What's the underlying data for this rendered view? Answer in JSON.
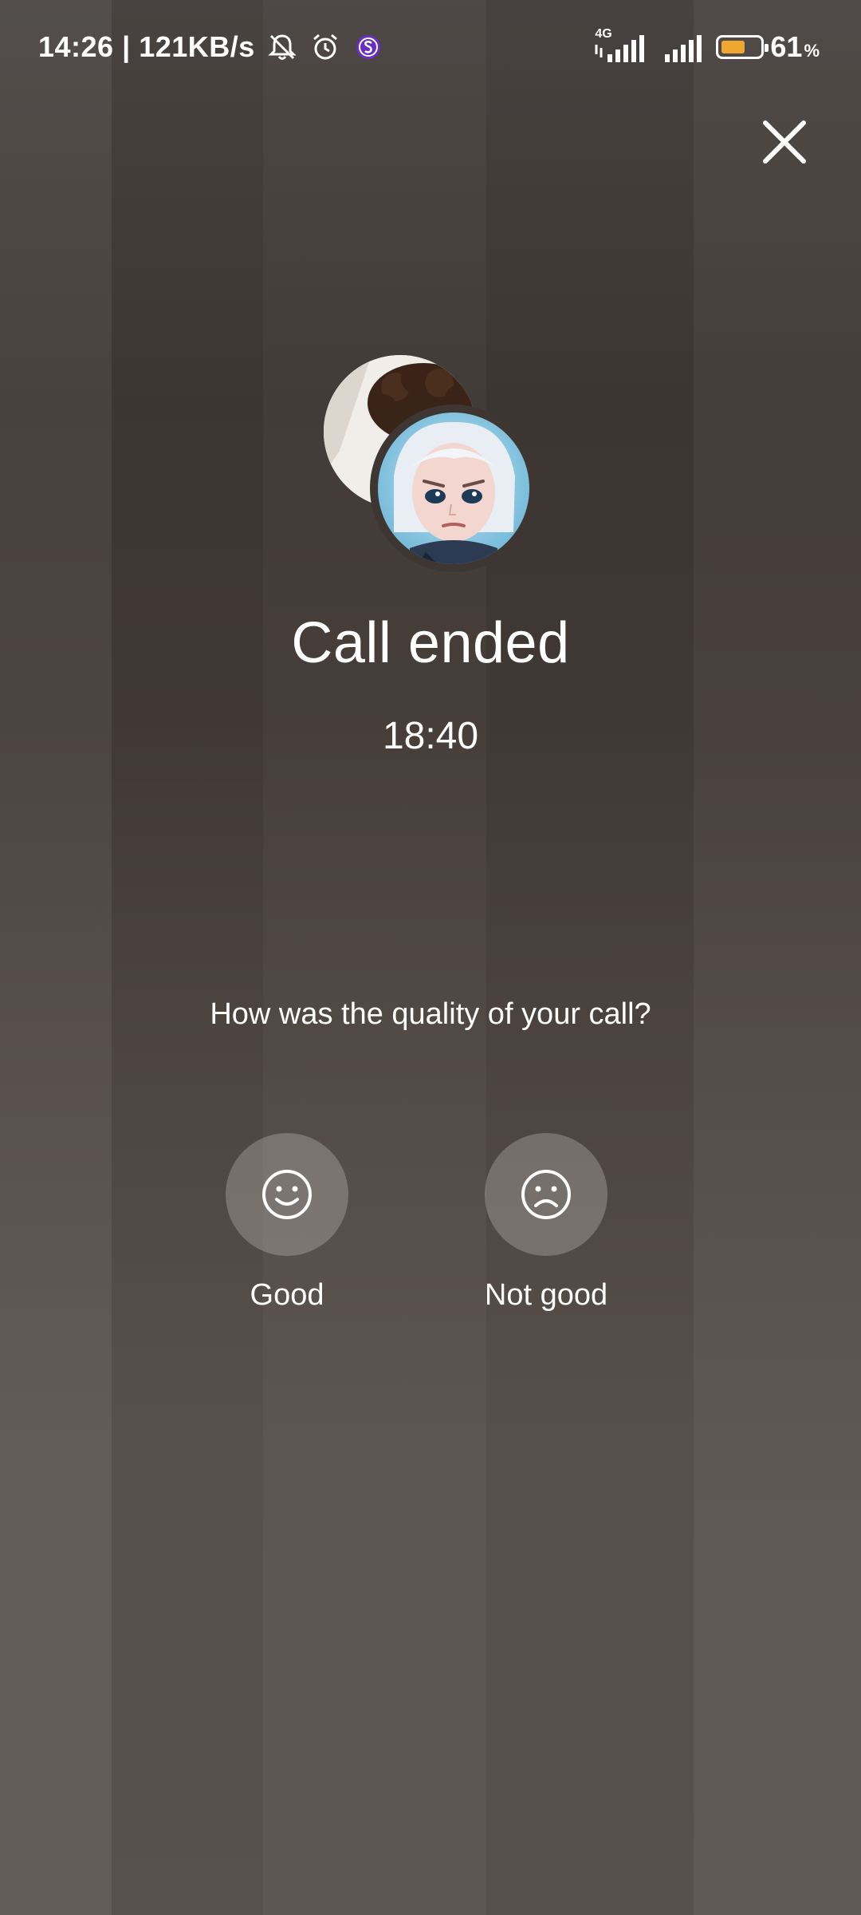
{
  "status_bar": {
    "time": "14:26",
    "separator": "|",
    "speed": "121KB/s",
    "network_type": "4G",
    "battery_percent": "61",
    "battery_unit": "%",
    "battery_level": 0.61,
    "battery_color": "#f0a732",
    "icons": [
      "mute-bell-icon",
      "alarm-icon",
      "app-s-icon",
      "signal-icon",
      "signal-icon",
      "battery-icon"
    ]
  },
  "call": {
    "title": "Call ended",
    "duration": "18:40"
  },
  "feedback": {
    "question": "How was the quality of your call?",
    "options": [
      {
        "label": "Good",
        "icon": "smile-face-icon"
      },
      {
        "label": "Not good",
        "icon": "sad-face-icon"
      }
    ]
  },
  "colors": {
    "background_top": "#4a4542",
    "background_bottom": "#5a5450",
    "text": "#ffffff"
  }
}
